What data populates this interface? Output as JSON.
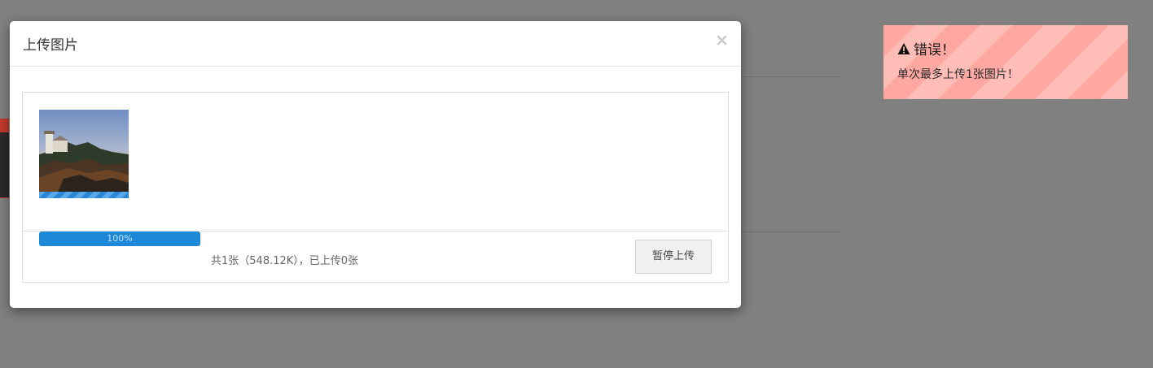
{
  "modal": {
    "title": "上传图片",
    "close_symbol": "×"
  },
  "uploader": {
    "files": [
      {
        "type": "image",
        "thumb_desc": "lighthouse-photo",
        "upload_progress": 1.0
      }
    ],
    "progress": {
      "value": 1.0,
      "label": "100%"
    },
    "summary": "共1张（548.12K），已上传0张",
    "pause_label": "暂停上传"
  },
  "toast": {
    "icon": "warning-icon",
    "title": "错误！",
    "message": "单次最多上传1张图片！"
  },
  "colors": {
    "overlay": "#808080",
    "progress": "#1e88d8",
    "toast_bg": "#ffa8a2"
  }
}
